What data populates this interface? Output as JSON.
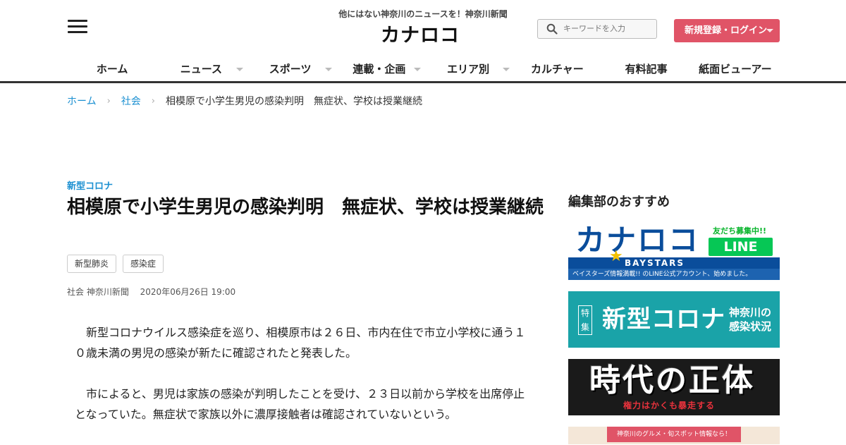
{
  "header": {
    "tagline": "他にはない神奈川のニュースを！神奈川新聞",
    "logo": "カナロコ",
    "search_placeholder": "キーワードを入力",
    "login_label": "新規登録・ログイン"
  },
  "nav": {
    "items": [
      {
        "label": "ホーム"
      },
      {
        "label": "ニュース"
      },
      {
        "label": "スポーツ"
      },
      {
        "label": "連載・企画"
      },
      {
        "label": "エリア別"
      },
      {
        "label": "カルチャー"
      },
      {
        "label": "有料記事"
      },
      {
        "label": "紙面ビューアー"
      }
    ]
  },
  "breadcrumb": {
    "home": "ホーム",
    "section": "社会",
    "current": "相模原で小学生男児の感染判明　無症状、学校は授業継続"
  },
  "article": {
    "category": "新型コロナ",
    "title": "相模原で小学生男児の感染判明　無症状、学校は授業継続",
    "tags": [
      "新型肺炎",
      "感染症"
    ],
    "meta_section": "社会 神奈川新聞",
    "date": "2020年06月26日 19:00",
    "paragraphs": [
      "新型コロナウイルス感染症を巡り、相模原市は２６日、市内在住で市立小学校に通う１０歳未満の男児の感染が新たに確認されたと発表した。",
      "市によると、男児は家族の感染が判明したことを受け、２３日以前から学校を出席停止となっていた。無症状で家族以外に濃厚接触者は確認されていないという。"
    ]
  },
  "sidebar": {
    "heading": "編集部のおすすめ",
    "banner1": {
      "logo": "カナロコ",
      "team": "BAYSTARS",
      "friend": "友だち募集中!!",
      "line": "LINE",
      "strip": "ベイスターズ情報満載!! のLINE公式アカウント、始めました。"
    },
    "banner2": {
      "feature": "特集",
      "main": "新型コロナ",
      "sub1": "神奈川の",
      "sub2": "感染状況"
    },
    "banner3": {
      "main": "時代の正体",
      "sub": "権力はかくも暴走する"
    },
    "banner4": {
      "strip": "神奈川のグルメ・旬スポット情報なら！"
    }
  },
  "colors": {
    "accent_blue": "#1a8fd1",
    "login_red": "#e05467",
    "corona_teal": "#1aa3a8",
    "line_green": "#06c755"
  }
}
